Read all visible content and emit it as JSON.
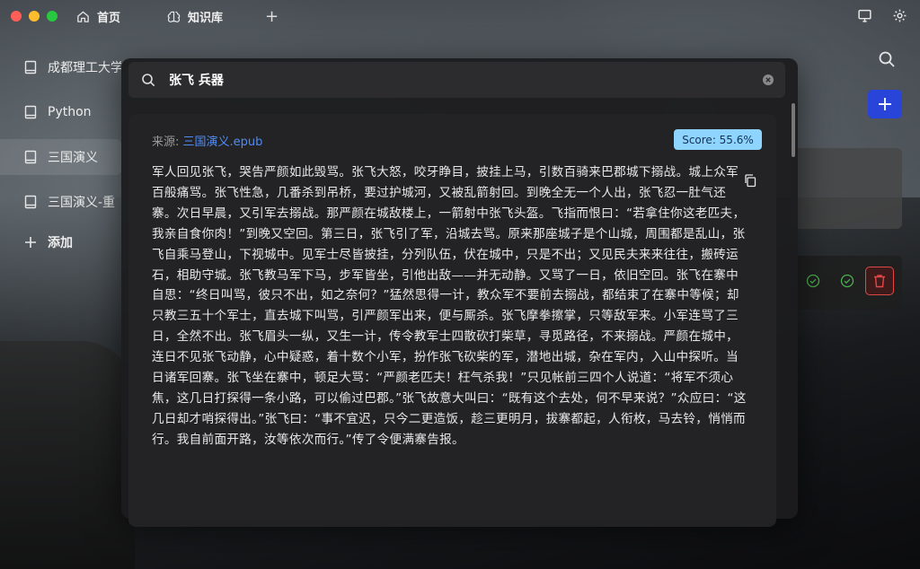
{
  "titlebar": {
    "tabs": [
      {
        "label": "首页",
        "icon": "home-icon"
      },
      {
        "label": "知识库",
        "icon": "brain-icon"
      }
    ],
    "add_tab": "+",
    "right_icons": [
      "monitor-icon",
      "gear-icon"
    ]
  },
  "sidebar": {
    "items": [
      {
        "label": "成都理工大学",
        "icon": "book-icon"
      },
      {
        "label": "Python",
        "icon": "book-icon"
      },
      {
        "label": "三国演义",
        "icon": "book-icon",
        "active": true
      },
      {
        "label": "三国演义-重",
        "icon": "book-icon"
      }
    ],
    "add_label": "添加"
  },
  "search": {
    "query": "张飞 兵器"
  },
  "result": {
    "source_label": "来源:",
    "source_file": "三国演义.epub",
    "score": "Score: 55.6%",
    "text": "军人回见张飞，哭告严颜如此毁骂。张飞大怒，咬牙睁目，披挂上马，引数百骑来巴郡城下搦战。城上众军百般痛骂。张飞性急，几番杀到吊桥，要过护城河，又被乱箭射回。到晚全无一个人出，张飞忍一肚气还寨。次日早晨，又引军去搦战。那严颜在城敌楼上，一箭射中张飞头盔。飞指而恨曰：“若拿住你这老匹夫，我亲自食你肉！”到晚又空回。第三日，张飞引了军，沿城去骂。原来那座城子是个山城，周围都是乱山，张飞自乘马登山，下视城中。见军士尽皆披挂，分列队伍，伏在城中，只是不出；又见民夫来来往往，搬砖运石，相助守城。张飞教马军下马，步军皆坐，引他出敌——并无动静。又骂了一日，依旧空回。张飞在寨中自思：“终日叫骂，彼只不出，如之奈何？”猛然思得一计，教众军不要前去搦战，都结束了在寨中等候；却只教三五十个军士，直去城下叫骂，引严颜军出来，便与厮杀。张飞摩拳擦掌，只等敌军来。小军连骂了三日，全然不出。张飞眉头一纵，又生一计，传令教军士四散砍打柴草，寻觅路径，不来搦战。严颜在城中，连日不见张飞动静，心中疑惑，着十数个小军，扮作张飞砍柴的军，潜地出城，杂在军内，入山中探听。当日诸军回寨。张飞坐在寨中，顿足大骂：“严颜老匹夫！枉气杀我！”只见帐前三四个人说道：“将军不须心焦，这几日打探得一条小路，可以偷过巴郡。”张飞故意大叫曰：“既有这个去处，何不早来说？”众应曰：“这几日却才哨探得出。”张飞曰：“事不宜迟，只今二更造饭，趁三更明月，拔寨都起，人衔枚，马去铃，悄悄而行。我自前面开路，汝等依次而行。”传了令便满寨告报。"
  },
  "right_panel": {
    "add_button": "+"
  },
  "colors": {
    "accent": "#2944d8",
    "score_badge": "#8fd3ff",
    "link": "#4f8cf5",
    "danger": "#e04848",
    "success": "#4caf50"
  }
}
